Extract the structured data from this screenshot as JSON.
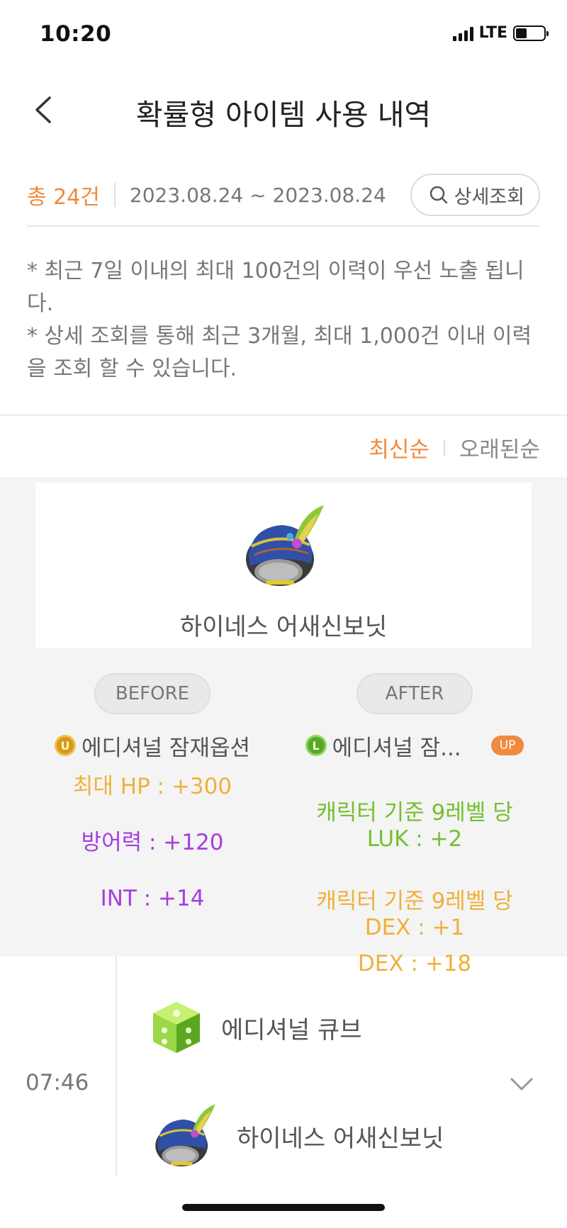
{
  "status_bar": {
    "time": "10:20",
    "network": "LTE",
    "battery_level": 0.4
  },
  "nav": {
    "title": "확률형 아이템 사용 내역",
    "back_icon": "chevron-left-icon"
  },
  "summary": {
    "total": "총 24건",
    "date_range": "2023.08.24 ~ 2023.08.24",
    "detail_button": "상세조회"
  },
  "notice": [
    "* 최근 7일 이내의 최대 100건의 이력이 우선 노출 됩니다.",
    "* 상세 조회를 통해 최근 3개월, 최대 1,000건 이내 이력을 조회 할 수 있습니다."
  ],
  "sort": {
    "latest": "최신순",
    "oldest": "오래된순",
    "selected": "latest"
  },
  "result": {
    "item_name": "하이네스 어새신보닛",
    "before": {
      "label": "BEFORE",
      "grade_badge": "U",
      "grade_name": "에디셔널 잠재옵션",
      "options": [
        "최대 HP : +300",
        "방어력 : +120",
        "INT : +14"
      ],
      "option_colors": [
        "#f0b03a",
        "#a63de0",
        "#a63de0"
      ]
    },
    "after": {
      "label": "AFTER",
      "grade_badge": "L",
      "grade_name": "에디셔널 잠...",
      "up_badge": "UP",
      "options": [
        "캐릭터 기준 9레벨 당\nLUK : +2",
        "캐릭터 기준 9레벨 당\nDEX : +1",
        "DEX : +18"
      ],
      "option_colors": [
        "#74c030",
        "#f0b03a",
        "#f0b03a"
      ]
    }
  },
  "history": {
    "time": "07:46",
    "cube_name": "에디셔널 큐브",
    "item_name": "하이네스 어새신보닛",
    "expand_icon": "chevron-down-icon"
  }
}
